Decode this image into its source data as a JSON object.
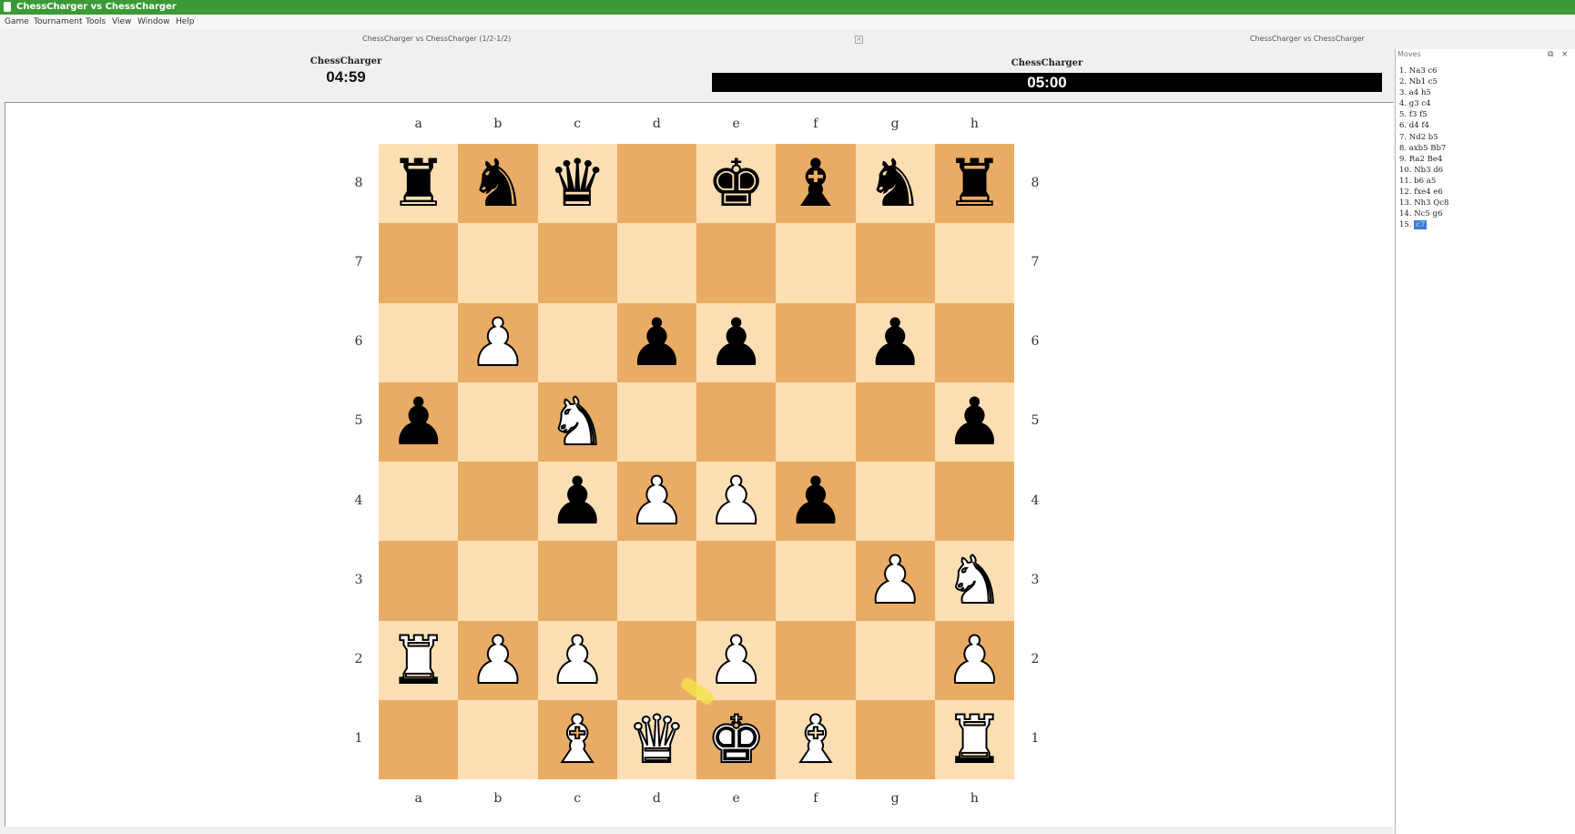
{
  "window": {
    "title": "ChessCharger vs ChessCharger"
  },
  "menu": [
    "Game",
    "Tournament",
    "Tools",
    "View",
    "Window",
    "Help"
  ],
  "tabs": {
    "game_tab": "ChessCharger vs ChessCharger (1/2-1/2)",
    "right_tab": "ChessCharger vs ChessCharger",
    "close_glyph": "×"
  },
  "players": {
    "left": {
      "name": "ChessCharger",
      "clock": "04:59"
    },
    "right": {
      "name": "ChessCharger",
      "clock": "05:00"
    }
  },
  "board": {
    "files": [
      "a",
      "b",
      "c",
      "d",
      "e",
      "f",
      "g",
      "h"
    ],
    "ranks": [
      "8",
      "7",
      "6",
      "5",
      "4",
      "3",
      "2",
      "1"
    ],
    "position": [
      [
        "bR",
        "bN",
        "bQ",
        "",
        "bK",
        "bB",
        "bN",
        "bR"
      ],
      [
        "",
        "",
        "",
        "",
        "",
        "",
        "",
        ""
      ],
      [
        "",
        "wP",
        "",
        "bP",
        "bP",
        "",
        "bP",
        ""
      ],
      [
        "bP",
        "",
        "wN",
        "",
        "",
        "",
        "",
        "bP"
      ],
      [
        "",
        "",
        "bP",
        "wP",
        "wP",
        "bP",
        "",
        ""
      ],
      [
        "",
        "",
        "",
        "",
        "",
        "",
        "wP",
        "wN"
      ],
      [
        "wR",
        "wP",
        "wP",
        "",
        "wP",
        "",
        "",
        "wP"
      ],
      [
        "",
        "",
        "wB",
        "wQ",
        "wK",
        "wB",
        "",
        "wR"
      ]
    ],
    "light_color": "#fedfb3",
    "dark_color": "#e9ac64"
  },
  "moves_panel": {
    "title": "Moves",
    "float_glyph": "⧉",
    "close_glyph": "×",
    "moves": [
      "1. Na3 c6",
      "2. Nb1 c5",
      "3. a4 h5",
      "4. g3 c4",
      "5. f3 f5",
      "6. d4 f4",
      "7. Nd2 b5",
      "8. axb5 Bb7",
      "9. Ra2 Be4",
      "10. Nb3 d6",
      "11. b6 a5",
      "12. fxe4 e6",
      "13. Nh3 Qc8",
      "14. Nc5 g6"
    ],
    "current_number": "15.",
    "current_move": "c7"
  }
}
